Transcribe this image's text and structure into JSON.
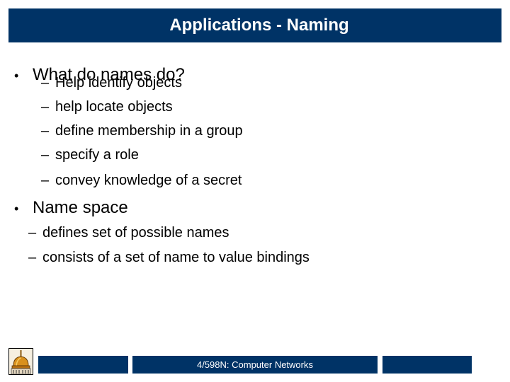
{
  "slide": {
    "title": "Applications - Naming",
    "bullets": [
      {
        "marker": "•",
        "text": "What do names do?",
        "subitems": [
          {
            "marker": "–",
            "text": "Help identify objects"
          },
          {
            "marker": "–",
            "text": "help locate objects"
          },
          {
            "marker": "–",
            "text": "define membership in a group"
          },
          {
            "marker": "–",
            "text": "specify a role"
          },
          {
            "marker": "–",
            "text": "convey knowledge of a secret"
          }
        ]
      },
      {
        "marker": "•",
        "text": "Name space",
        "subitems": [
          {
            "marker": "–",
            "text": "defines set of possible names"
          },
          {
            "marker": "–",
            "text": "consists of a set of name to value bindings"
          }
        ]
      }
    ]
  },
  "footer": {
    "logo_icon": "golden-dome-icon",
    "center_text": "4/598N: Computer Networks",
    "left_text": "",
    "right_text": ""
  },
  "colors": {
    "brand": "#003366"
  }
}
